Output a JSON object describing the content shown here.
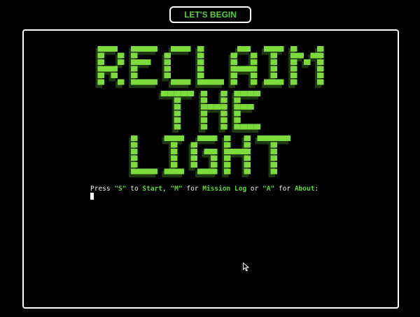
{
  "header": {
    "begin_label": "LET'S BEGIN"
  },
  "logo": {
    "lines": [
      "RECLAIM",
      "THE",
      "LIGHT"
    ],
    "color": "#7ddb3c",
    "shadow_color": "#1f3a12"
  },
  "prompt": {
    "press": "Press ",
    "key_start": "\"S\"",
    "to": " to ",
    "start_label": "Start",
    "comma": ", ",
    "key_mission": "\"M\"",
    "for1": " for ",
    "mission_label": "Mission Log",
    "or": " or ",
    "key_about": "\"A\"",
    "for2": " for ",
    "about_label": "About",
    "colon": ":"
  },
  "colors": {
    "accent": "#5ed92f",
    "frame": "#ffffff",
    "background": "#000000"
  },
  "icons": {
    "pointer": "mouse-pointer-icon"
  }
}
